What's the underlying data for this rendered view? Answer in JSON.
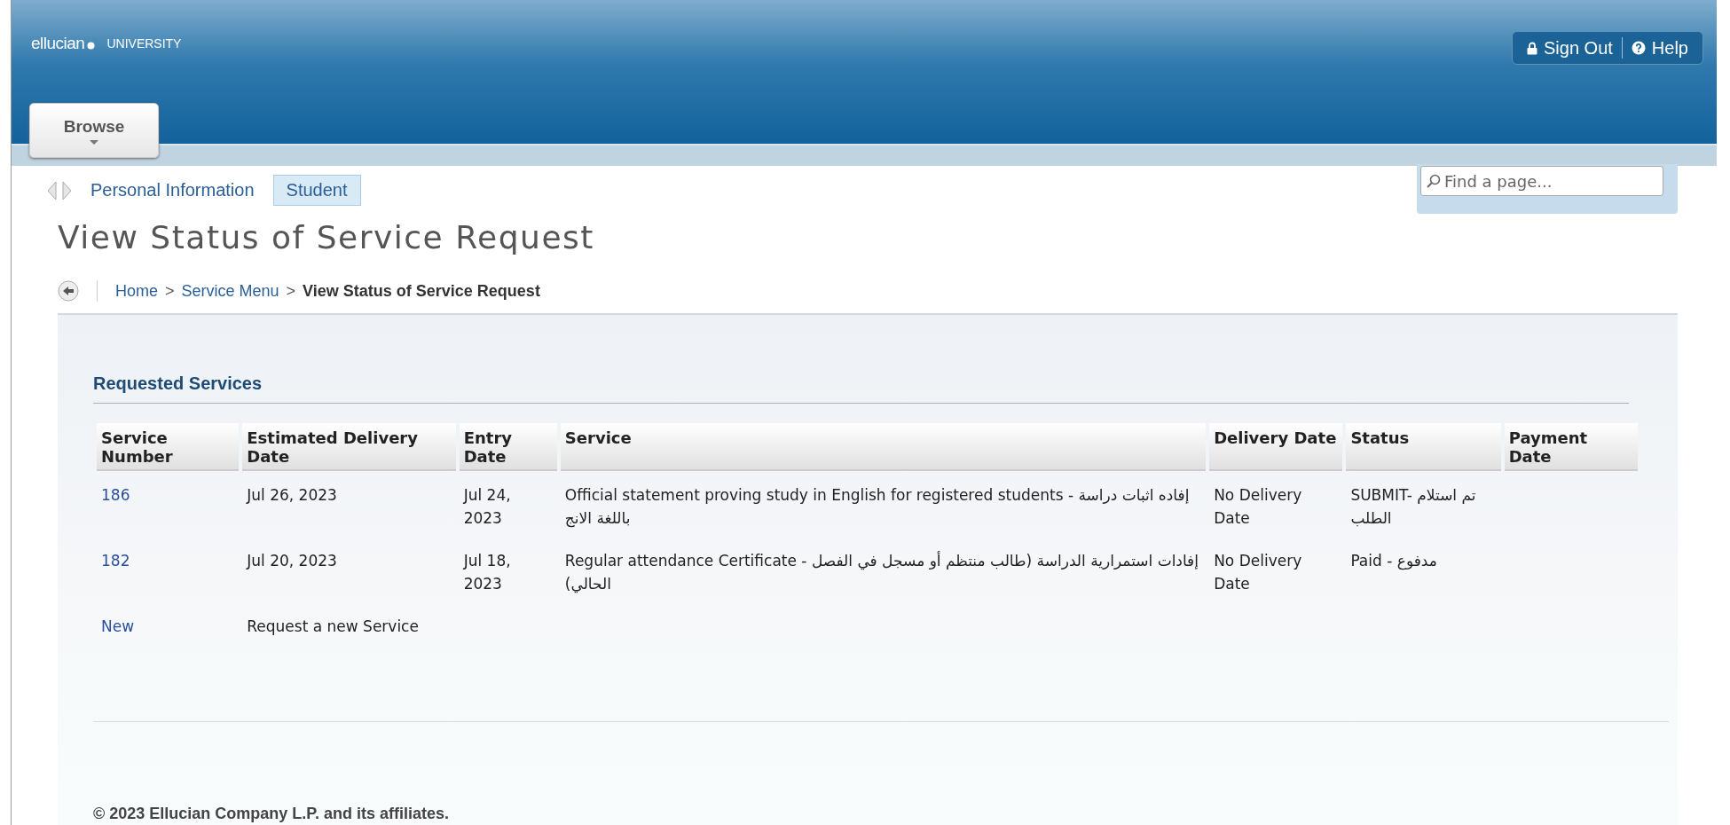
{
  "header": {
    "logo": "ellucian",
    "logo_sub": "UNIVERSITY",
    "actions": [
      {
        "kind": "lock",
        "label": "Sign Out"
      },
      {
        "kind": "help",
        "label": "Help"
      }
    ],
    "browse": "Browse"
  },
  "nav": {
    "tabs": [
      {
        "label": "Personal Information",
        "selected": false
      },
      {
        "label": "Student",
        "selected": true
      }
    ],
    "search": {
      "placeholder": "Find a page..."
    }
  },
  "page_title": "View Status of Service Request",
  "breadcrumb": [
    {
      "kind": "link",
      "label": "Home"
    },
    {
      "kind": "separator",
      "label": ">"
    },
    {
      "kind": "link",
      "label": "Service Menu"
    },
    {
      "kind": "separator",
      "label": ">"
    },
    {
      "kind": "current",
      "label": "View Status of Service Request"
    }
  ],
  "section_title": "Requested Services",
  "table": {
    "columns": [
      "Service Number",
      "Estimated Delivery Date",
      "Entry Date",
      "Service",
      "Delivery Date",
      "Status",
      "Payment Date"
    ],
    "rows": [
      {
        "cells": [
          "186",
          "Jul 26, 2023",
          "Jul 24, 2023",
          "Official statement proving study in English for registered students - إفاده اثبات دراسة باللغة الانج",
          "No Delivery Date",
          "SUBMIT- تم استلام الطلب",
          ""
        ]
      },
      {
        "cells": [
          "182",
          "Jul 20, 2023",
          "Jul 18, 2023",
          "Regular attendance Certificate - إفادات استمرارية الدراسة (طالب منتظم أو مسجل في الفصل الحالي)",
          "No Delivery Date",
          "Paid - مدفوع",
          ""
        ]
      },
      {
        "cells": [
          "New",
          "Request a new Service"
        ]
      }
    ]
  },
  "footer": "© 2023 Ellucian Company L.P. and its affiliates."
}
